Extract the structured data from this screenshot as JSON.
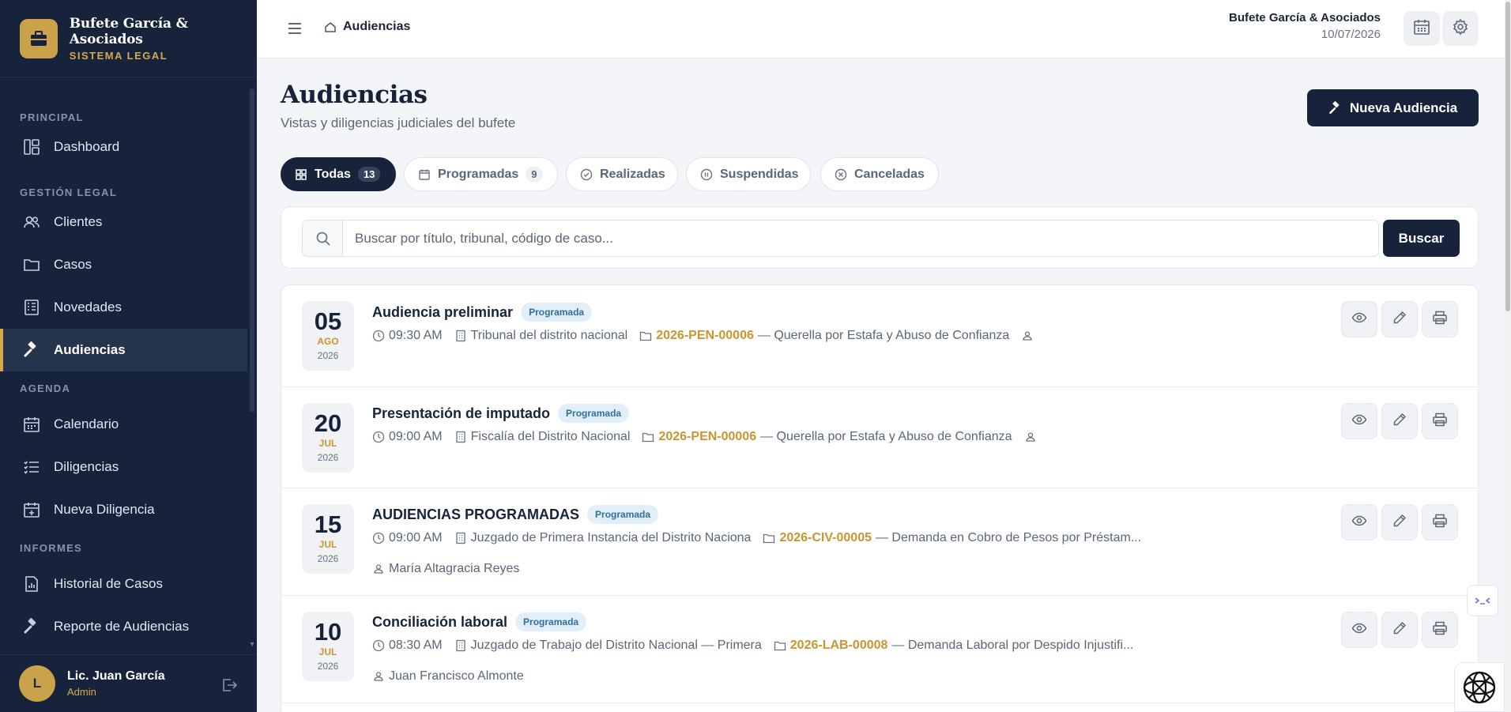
{
  "brand": {
    "name": "Bufete García & Asociados",
    "subtitle": "SISTEMA LEGAL"
  },
  "sidebar": {
    "sections": [
      {
        "label": "PRINCIPAL"
      },
      {
        "label": "GESTIÓN LEGAL"
      },
      {
        "label": "AGENDA"
      },
      {
        "label": "INFORMES"
      }
    ],
    "items": [
      {
        "label": "Dashboard",
        "icon": "dashboard-icon"
      },
      {
        "label": "Clientes",
        "icon": "users-icon"
      },
      {
        "label": "Casos",
        "icon": "folder-icon"
      },
      {
        "label": "Novedades",
        "icon": "news-icon"
      },
      {
        "label": "Audiencias",
        "icon": "gavel-icon",
        "active": true
      },
      {
        "label": "Calendario",
        "icon": "calendar-icon"
      },
      {
        "label": "Diligencias",
        "icon": "list-icon"
      },
      {
        "label": "Nueva Diligencia",
        "icon": "calendar-plus-icon"
      },
      {
        "label": "Historial de Casos",
        "icon": "report-icon"
      },
      {
        "label": "Reporte de Audiencias",
        "icon": "gavel-icon"
      }
    ]
  },
  "user": {
    "initial": "L",
    "name": "Lic. Juan García",
    "role": "Admin"
  },
  "topbar": {
    "breadcrumb": "Audiencias",
    "firm_name": "Bufete García & Asociados",
    "date": "10/07/2026"
  },
  "page": {
    "title": "Audiencias",
    "subtitle": "Vistas y diligencias judiciales del bufete",
    "new_button": "Nueva Audiencia"
  },
  "tabs": [
    {
      "label": "Todas",
      "count": "13",
      "active": true
    },
    {
      "label": "Programadas",
      "count": "9"
    },
    {
      "label": "Realizadas"
    },
    {
      "label": "Suspendidas"
    },
    {
      "label": "Canceladas"
    }
  ],
  "search": {
    "placeholder": "Buscar por título, tribunal, código de caso...",
    "value": "",
    "button": "Buscar"
  },
  "hearings": [
    {
      "day": "05",
      "month": "AGO",
      "year": "2026",
      "title": "Audiencia preliminar",
      "status": "Programada",
      "time": "09:30 AM",
      "court": "Tribunal del distrito nacional",
      "case_code": "2026-PEN-00006",
      "case_desc": "— Querella por Estafa y Abuso de Confianza",
      "person": ""
    },
    {
      "day": "20",
      "month": "JUL",
      "year": "2026",
      "title": "Presentación de imputado",
      "status": "Programada",
      "time": "09:00 AM",
      "court": "Fiscalía del Distrito Nacional",
      "case_code": "2026-PEN-00006",
      "case_desc": "— Querella por Estafa y Abuso de Confianza",
      "person": ""
    },
    {
      "day": "15",
      "month": "JUL",
      "year": "2026",
      "title": "AUDIENCIAS PROGRAMADAS",
      "status": "Programada",
      "time": "09:00 AM",
      "court": "Juzgado de Primera Instancia del Distrito Naciona",
      "case_code": "2026-CIV-00005",
      "case_desc": "— Demanda en Cobro de Pesos por Préstam...",
      "person": "María Altagracia Reyes"
    },
    {
      "day": "10",
      "month": "JUL",
      "year": "2026",
      "title": "Conciliación laboral",
      "status": "Programada",
      "time": "08:30 AM",
      "court": "Juzgado de Trabajo del Distrito Nacional — Primera",
      "case_code": "2026-LAB-00008",
      "case_desc": "— Demanda Laboral por Despido Injustifi...",
      "person": "Juan Francisco Almonte"
    }
  ]
}
